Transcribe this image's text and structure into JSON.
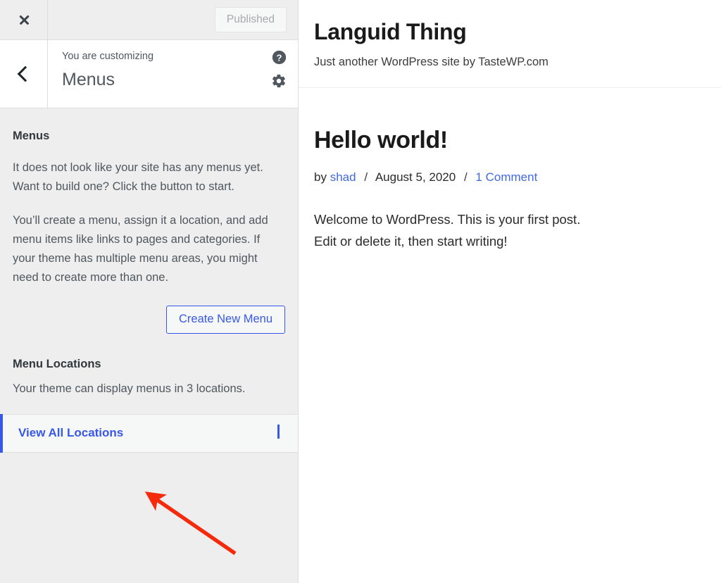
{
  "customizer": {
    "topbar": {
      "close_label": "×",
      "publish_button": "Published"
    },
    "header": {
      "eyebrow": "You are customizing",
      "title": "Menus",
      "help_icon": "help-icon",
      "gear_icon": "gear-icon"
    },
    "panel": {
      "section_title": "Menus",
      "paragraph_1": "It does not look like your site has any menus yet. Want to build one? Click the button to start.",
      "paragraph_2": "You’ll create a menu, assign it a location, and add menu items like links to pages and categories. If your theme has multiple menu areas, you might need to create more than one.",
      "create_menu_button": "Create New Menu",
      "locations_title": "Menu Locations",
      "locations_description": "Your theme can display menus in 3 locations.",
      "view_all_locations": "View All Locations"
    }
  },
  "preview": {
    "site_title": "Languid Thing",
    "site_tagline": "Just another WordPress site by TasteWP.com",
    "post": {
      "title": "Hello world!",
      "author_prefix": "by",
      "author": "shad",
      "separator_1": "/",
      "date": "August 5, 2020",
      "separator_2": "/",
      "comments": "1 Comment",
      "body_line_1": "Welcome to WordPress. This is your first post.",
      "body_line_2": "Edit or delete it, then start writing!"
    }
  },
  "annotation": {
    "arrow_color": "#f42a0a",
    "arrow_target": "view-all-locations-row"
  },
  "colors": {
    "accent_blue": "#3858e9",
    "link_blue": "#4169e1",
    "panel_bg": "#eeeeee",
    "text_dark": "#32373c",
    "text_body": "#50575e",
    "annotation_red": "#f42a0a"
  }
}
